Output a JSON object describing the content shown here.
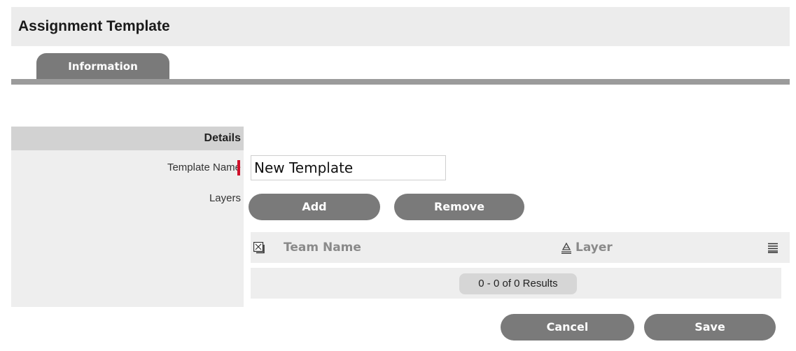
{
  "header": {
    "title": "Assignment Template"
  },
  "tabs": [
    {
      "label": "Information",
      "active": true
    }
  ],
  "form": {
    "section_title": "Details",
    "template_name_label": "Template Name",
    "template_name_value": "New Template",
    "layers_label": "Layers",
    "add_label": "Add",
    "remove_label": "Remove"
  },
  "grid": {
    "columns": [
      "Team Name",
      "Layer"
    ],
    "select_all_icon": "checkbox-cross-icon",
    "sort_icon": "sort-ascending-icon",
    "column_menu_icon": "column-menu-icon",
    "results_text": "0 - 0 of 0 Results",
    "rows": []
  },
  "footer": {
    "cancel_label": "Cancel",
    "save_label": "Save"
  },
  "colors": {
    "button_gray": "#7a7a7a",
    "required_marker": "#d0102a",
    "panel_bg": "#eeeeee",
    "header_bg": "#ececec"
  }
}
